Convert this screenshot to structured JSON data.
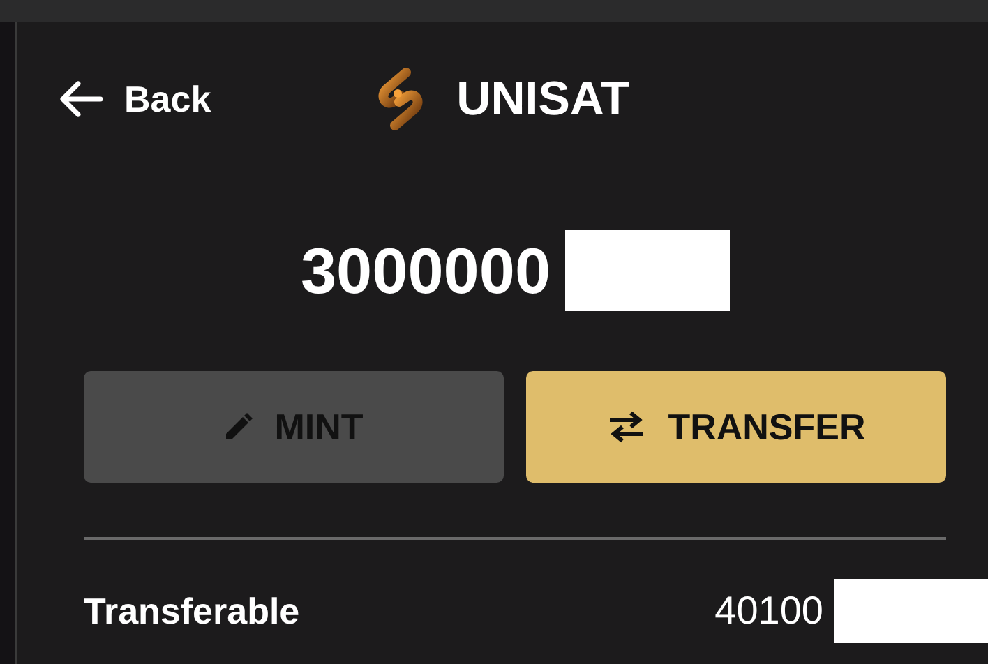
{
  "header": {
    "back_label": "Back",
    "brand": "UNISAT"
  },
  "balance": {
    "amount": "3000000"
  },
  "buttons": [
    {
      "label": "MINT",
      "kind": "mint"
    },
    {
      "label": "TRANSFER",
      "kind": "transfer"
    }
  ],
  "transferable": {
    "label": "Transferable",
    "amount": "40100"
  }
}
